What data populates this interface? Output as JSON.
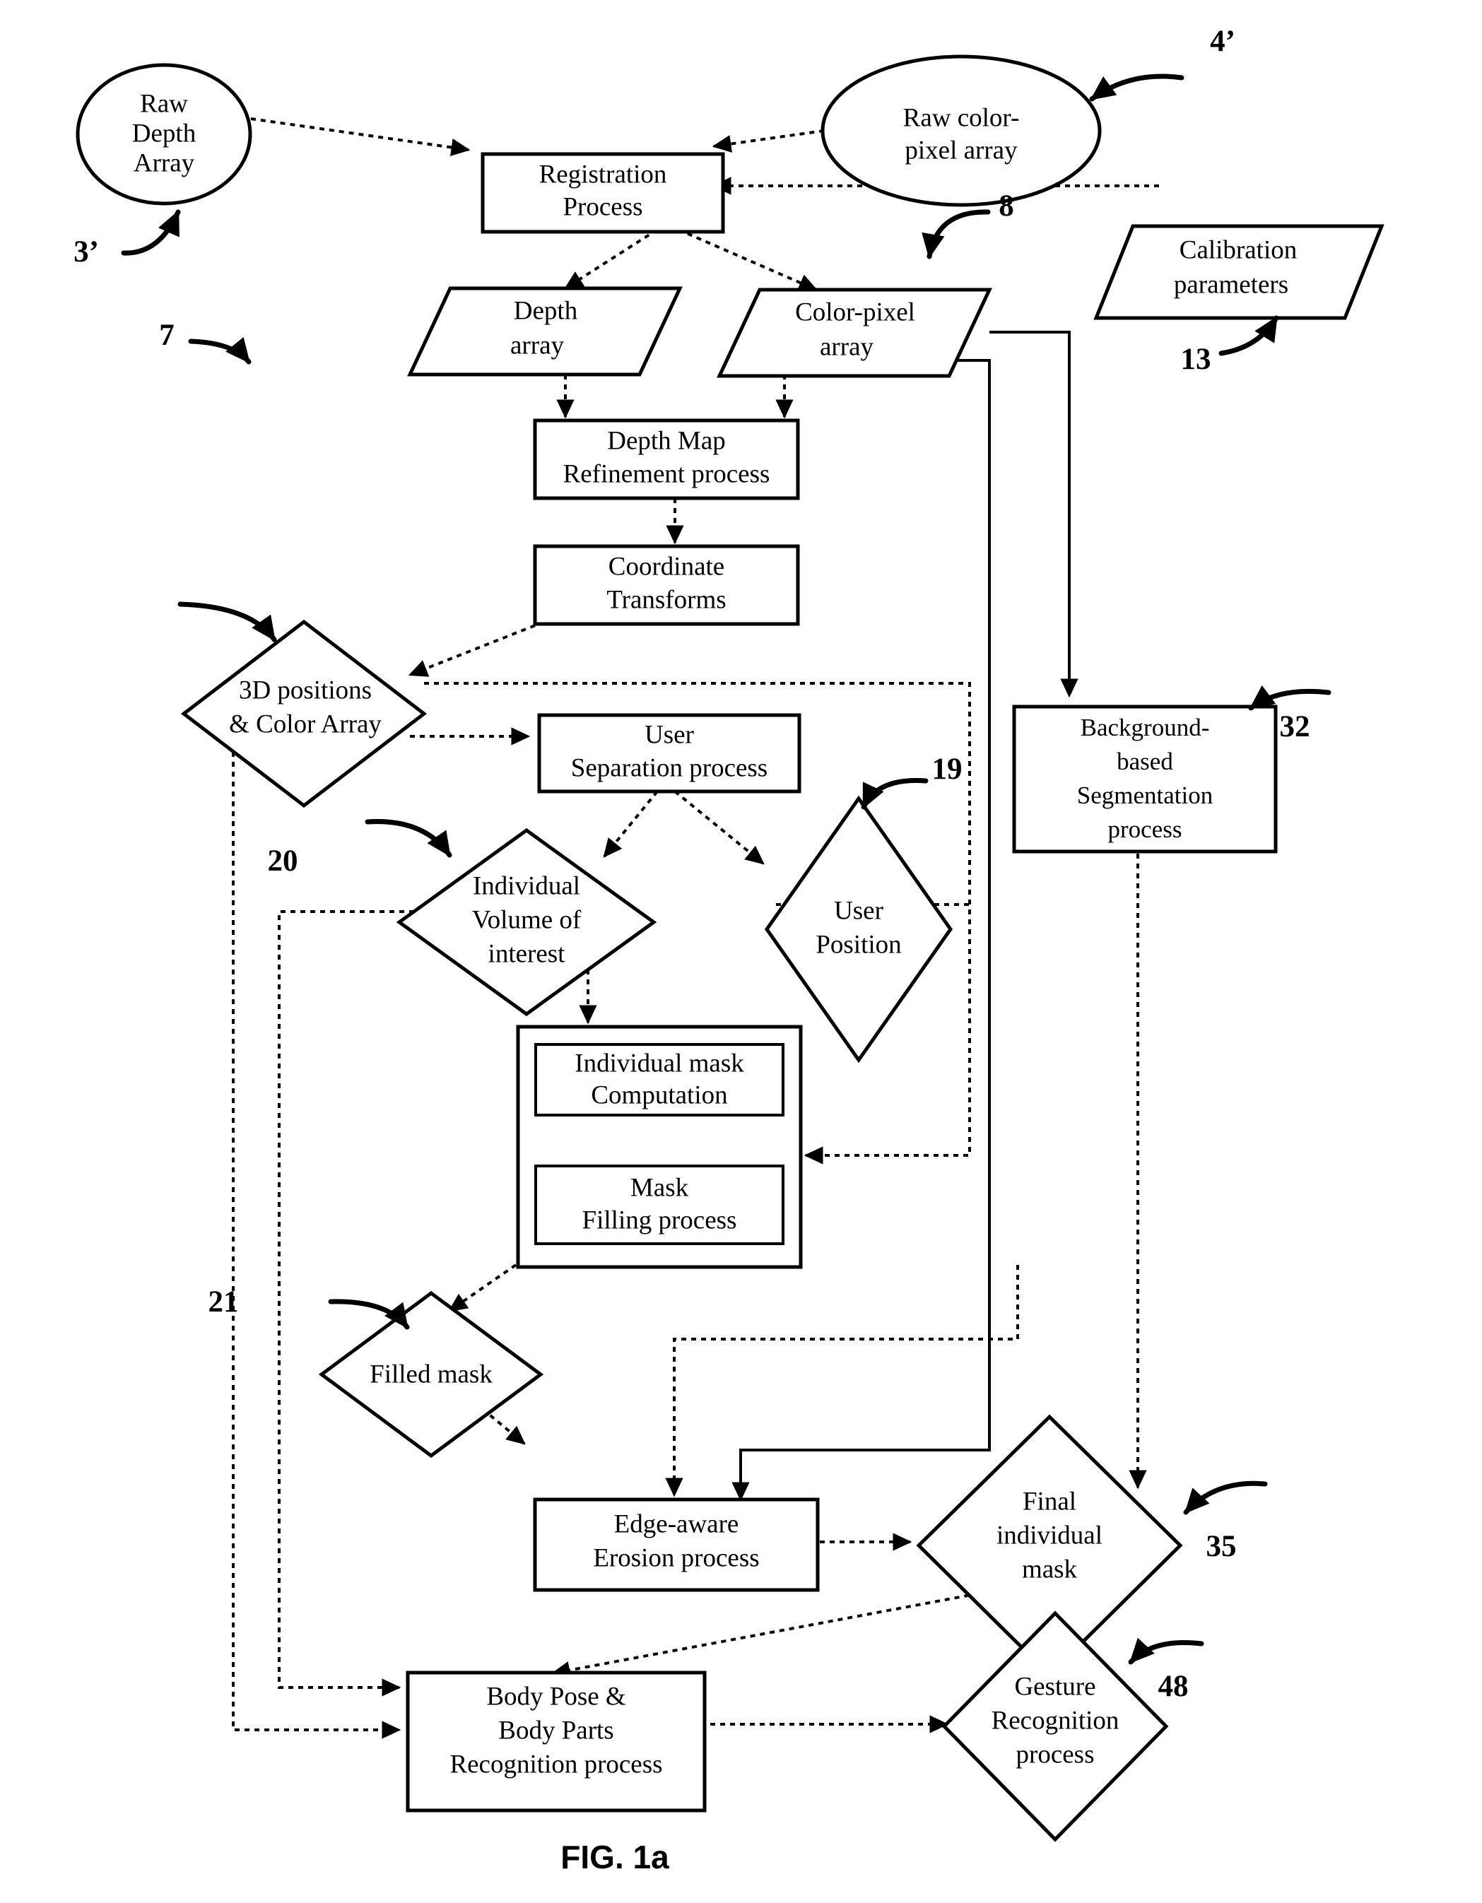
{
  "figure": {
    "caption": "FIG. 1a",
    "domain_kind": "patent-flowchart"
  },
  "nodes": {
    "raw_depth_array": {
      "label_lines": [
        "Raw",
        "Depth",
        "Array"
      ],
      "shape": "ellipse",
      "ref": "3’"
    },
    "raw_color_pixel_array": {
      "label_lines": [
        "Raw color-",
        "pixel array"
      ],
      "shape": "ellipse",
      "ref": "4’"
    },
    "registration_process": {
      "label_lines": [
        "Registration",
        "Process"
      ],
      "shape": "rect"
    },
    "calibration_parameters": {
      "label_lines": [
        "Calibration",
        "parameters"
      ],
      "shape": "parallelogram",
      "ref": "13"
    },
    "depth_array": {
      "label_lines": [
        "Depth",
        "array"
      ],
      "shape": "parallelogram",
      "ref": "7"
    },
    "color_pixel_array": {
      "label_lines": [
        "Color-pixel",
        "array"
      ],
      "shape": "parallelogram",
      "ref": "8"
    },
    "depth_map_refinement": {
      "label_lines": [
        "Depth Map",
        "Refinement process"
      ],
      "shape": "rect"
    },
    "coordinate_transforms": {
      "label_lines": [
        "Coordinate",
        "Transforms"
      ],
      "shape": "rect"
    },
    "positions_color_array": {
      "label_lines": [
        "3D positions",
        "& Color Array"
      ],
      "shape": "diamond"
    },
    "user_separation_process": {
      "label_lines": [
        "User",
        "Separation process"
      ],
      "shape": "rect"
    },
    "background_segmentation": {
      "label_lines": [
        "Background-",
        "based",
        "Segmentation",
        "process"
      ],
      "shape": "rect",
      "ref": "32"
    },
    "individual_volume_of_interest": {
      "label_lines": [
        "Individual",
        "Volume of",
        "interest"
      ],
      "shape": "diamond",
      "ref": "20"
    },
    "user_position": {
      "label_lines": [
        "User",
        "Position"
      ],
      "shape": "diamond",
      "ref": "19"
    },
    "individual_mask_computation": {
      "label_lines": [
        "Individual mask",
        "Computation"
      ],
      "shape": "rect"
    },
    "mask_filling_process": {
      "label_lines": [
        "Mask",
        "Filling process"
      ],
      "shape": "rect"
    },
    "filled_mask": {
      "label_lines": [
        "Filled mask"
      ],
      "shape": "diamond",
      "ref": "21"
    },
    "edge_aware_erosion": {
      "label_lines": [
        "Edge-aware",
        "Erosion process"
      ],
      "shape": "rect"
    },
    "final_individual_mask": {
      "label_lines": [
        "Final",
        "individual",
        "mask"
      ],
      "shape": "diamond",
      "ref": "35"
    },
    "body_pose_recognition": {
      "label_lines": [
        "Body Pose &",
        "Body Parts",
        "Recognition process"
      ],
      "shape": "rect"
    },
    "gesture_recognition": {
      "label_lines": [
        "Gesture",
        "Recognition",
        "process"
      ],
      "shape": "diamond",
      "ref": "48"
    }
  },
  "reference_numerals": [
    {
      "id": "ref-3",
      "text": "3’"
    },
    {
      "id": "ref-4",
      "text": "4’"
    },
    {
      "id": "ref-7",
      "text": "7"
    },
    {
      "id": "ref-8",
      "text": "8"
    },
    {
      "id": "ref-13",
      "text": "13"
    },
    {
      "id": "ref-19",
      "text": "19"
    },
    {
      "id": "ref-20",
      "text": "20"
    },
    {
      "id": "ref-21",
      "text": "21"
    },
    {
      "id": "ref-32",
      "text": "32"
    },
    {
      "id": "ref-35",
      "text": "35"
    },
    {
      "id": "ref-48",
      "text": "48"
    }
  ],
  "colors": {
    "ink": "#000000",
    "paper": "#ffffff"
  }
}
